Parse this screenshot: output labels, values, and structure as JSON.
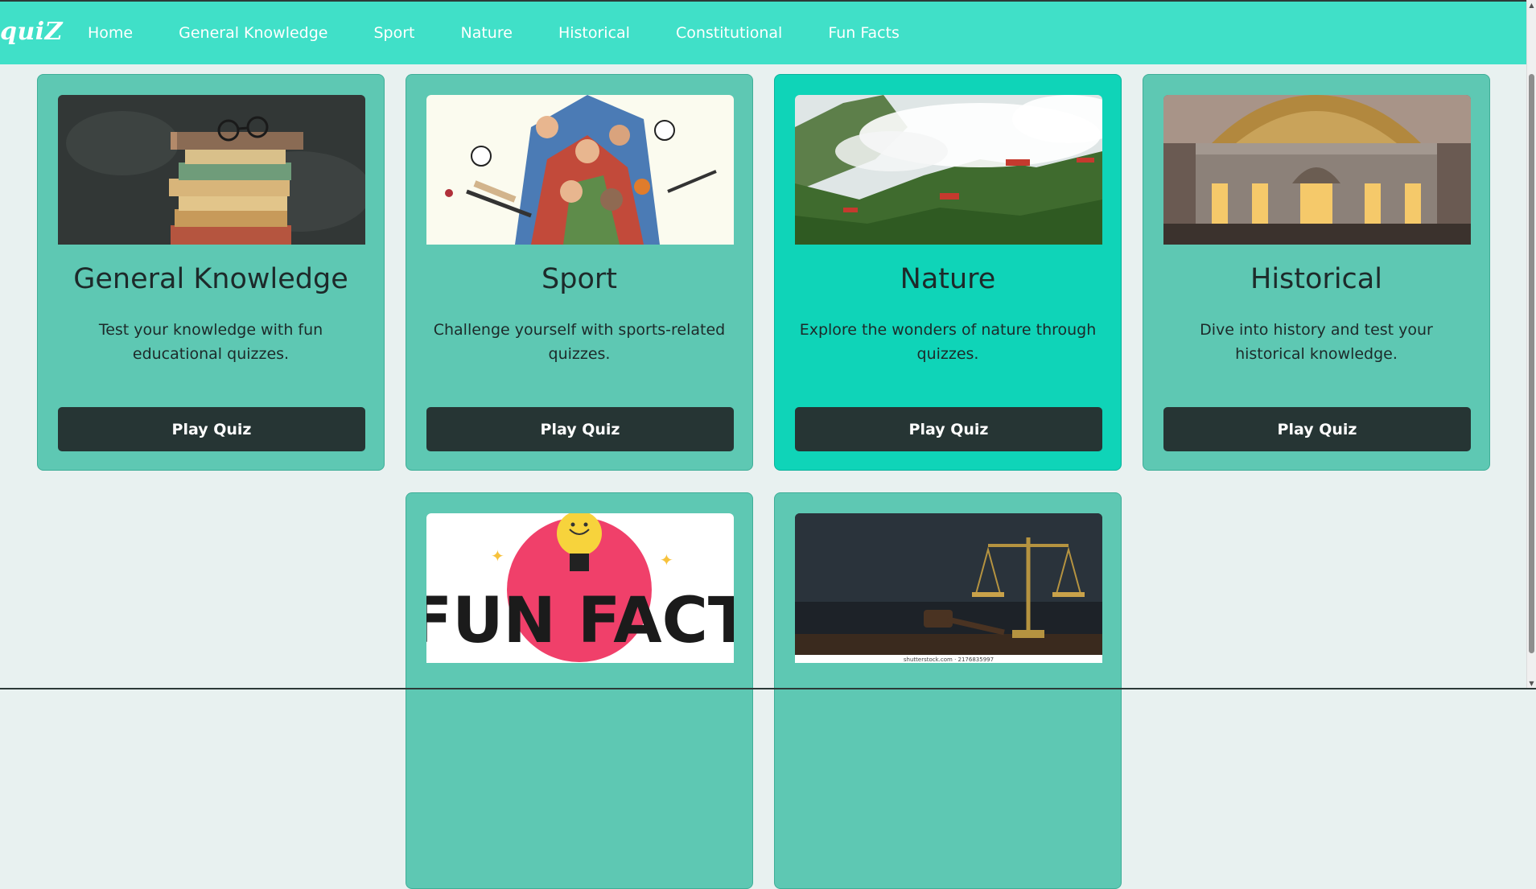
{
  "brand": "quiZ",
  "nav": {
    "links": [
      "Home",
      "General Knowledge",
      "Sport",
      "Nature",
      "Historical",
      "Constitutional",
      "Fun Facts"
    ]
  },
  "cards": [
    {
      "title": "General Knowledge",
      "text": "Test your knowledge with fun educational quizzes.",
      "button": "Play Quiz",
      "image": "books-with-glasses"
    },
    {
      "title": "Sport",
      "text": "Challenge yourself with sports-related quizzes.",
      "button": "Play Quiz",
      "image": "athletes-illustration"
    },
    {
      "title": "Nature",
      "text": "Explore the wonders of nature through quizzes.",
      "button": "Play Quiz",
      "image": "misty-forest-mountains"
    },
    {
      "title": "Historical",
      "text": "Dive into history and test your historical knowledge.",
      "button": "Play Quiz",
      "image": "historic-palace"
    },
    {
      "image": "fun-fact-lightbulb",
      "image_text": "FUN FACT"
    },
    {
      "image": "scales-of-justice-gavel",
      "image_caption": "shutterstock.com · 2176835997"
    }
  ],
  "colors": {
    "navbar": "#40e0c8",
    "card": "#5ec8b3",
    "card_active": "#0fd4b8",
    "button": "#263534",
    "page_bg": "#e8f1f0"
  }
}
